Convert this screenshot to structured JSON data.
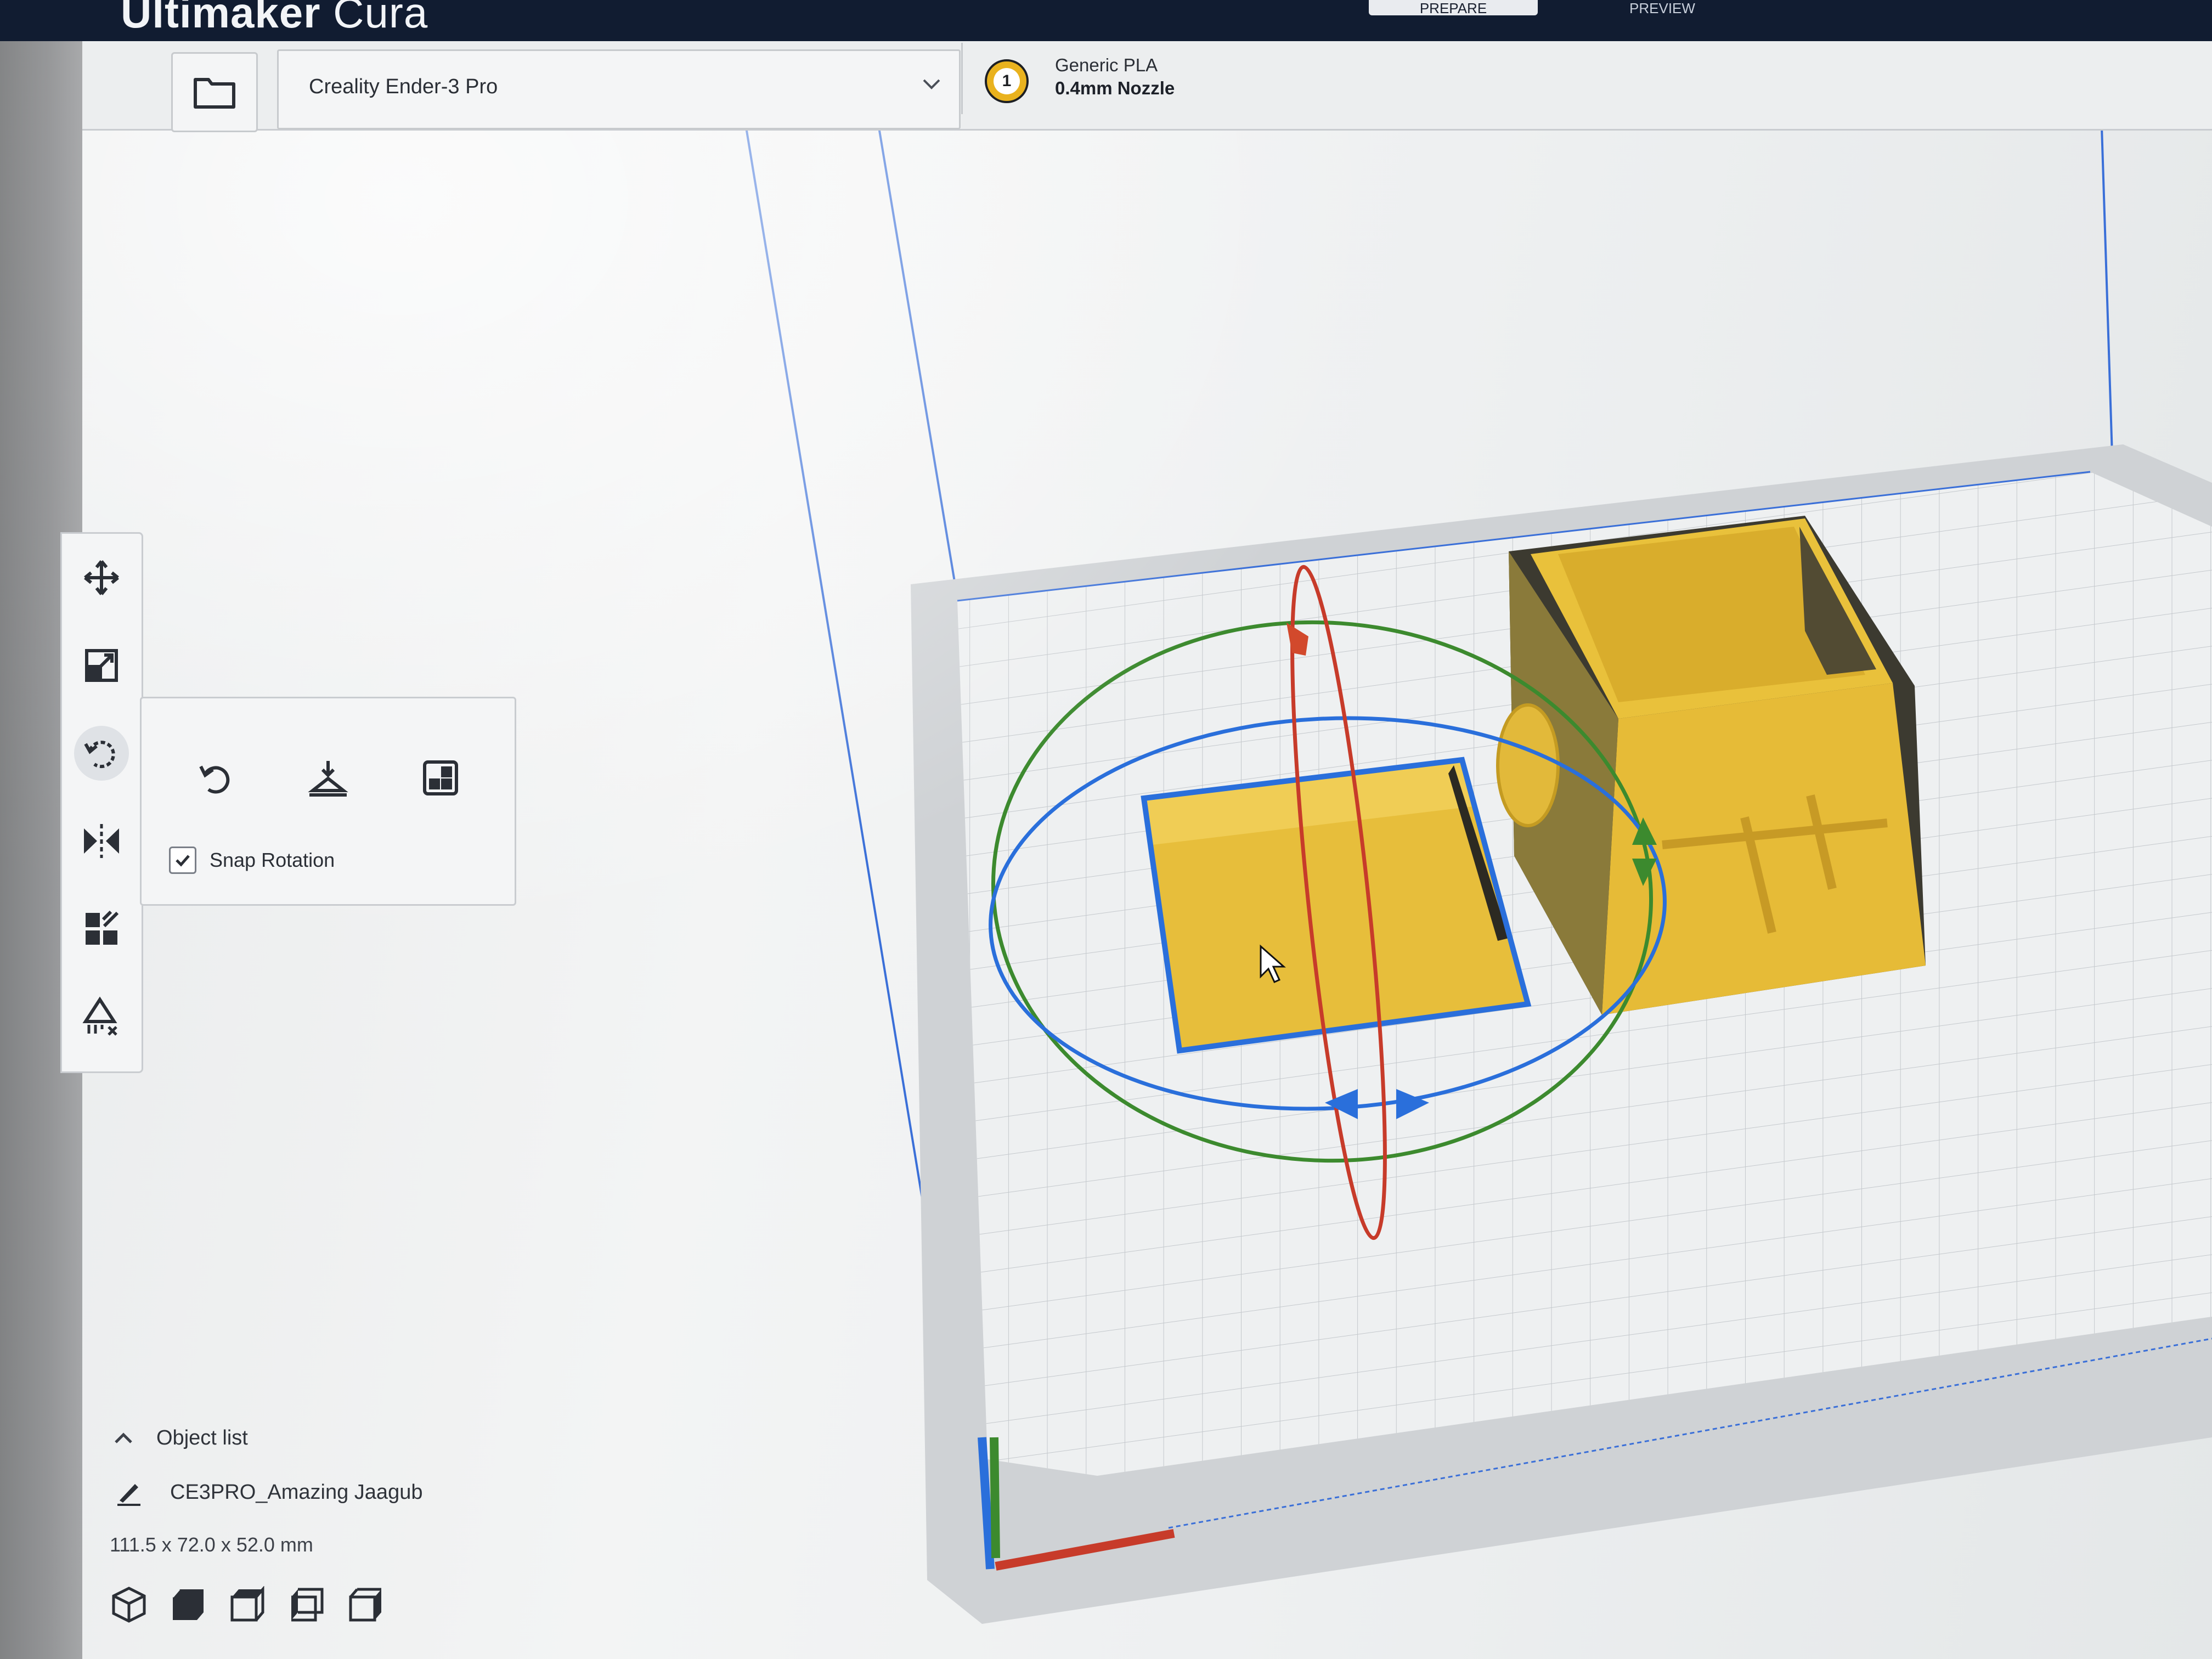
{
  "app": {
    "title_bold": "Ultimaker",
    "title_light": " Cura"
  },
  "header": {
    "stages": [
      "PREPARE",
      "PREVIEW"
    ],
    "printer": "Creality Ender-3 Pro",
    "extruder_number": "1",
    "material": "Generic PLA",
    "nozzle": "0.4mm Nozzle"
  },
  "tools": {
    "items": [
      "move-icon",
      "scale-icon",
      "rotate-icon",
      "mirror-icon",
      "per-model-settings-icon",
      "support-blocker-icon"
    ],
    "active": "rotate-icon"
  },
  "rotate_panel": {
    "buttons": [
      "reset-rotation-icon",
      "lay-flat-icon",
      "select-face-to-align-icon"
    ],
    "snap_rotation_label": "Snap Rotation",
    "snap_rotation_checked": true
  },
  "object_list": {
    "toggle_label": "Object list",
    "object_name": "CE3PRO_Amazing Jaagub",
    "dimensions": "111.5 x 72.0 x 52.0 mm"
  },
  "view_buttons": [
    "3d-view-icon",
    "front-view-icon",
    "top-view-icon",
    "left-view-icon",
    "right-view-icon"
  ],
  "colors": {
    "title_bar": "#111c31",
    "model_yellow": "#e8bf3c",
    "selection_blue": "#2a6fdb",
    "rot_red": "#c73b2a",
    "rot_green": "#3c8a2e",
    "build_plate": "#d9dcde"
  }
}
